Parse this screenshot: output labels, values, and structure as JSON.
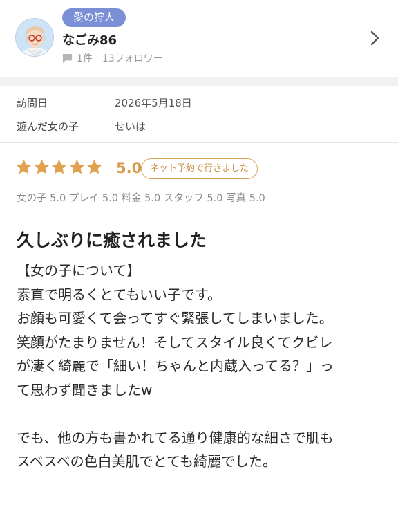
{
  "profile": {
    "badge": "愛の狩人",
    "username": "なごみ86",
    "review_count": "1件",
    "followers": "13フォロワー"
  },
  "visit": {
    "date_label": "訪問日",
    "date_value": "2026年5月18日",
    "girl_label": "遊んだ女の子",
    "girl_value": "せいは"
  },
  "rating": {
    "stars": 5,
    "score": "5.0",
    "booking_badge": "ネット予約で行きました",
    "sub_scores": "女の子 5.0 プレイ 5.0 料金 5.0 スタッフ 5.0 写真 5.0",
    "star_color": "#e0a24e"
  },
  "review": {
    "title": "久しぶりに癒されました",
    "lines": [
      "【女の子について】",
      "素直で明るくとてもいい子です。",
      "お顔も可愛くて会ってすぐ緊張してしまいました。",
      "笑顔がたまりません！そしてスタイル良くてクビレ",
      "が凄く綺麗で「細い！ちゃんと内蔵入ってる？」っ",
      "て思わず聞きましたw",
      "",
      "でも、他の方も書かれてる通り健康的な細さで肌も",
      "スベスベの色白美肌でとても綺麗でした。"
    ]
  }
}
